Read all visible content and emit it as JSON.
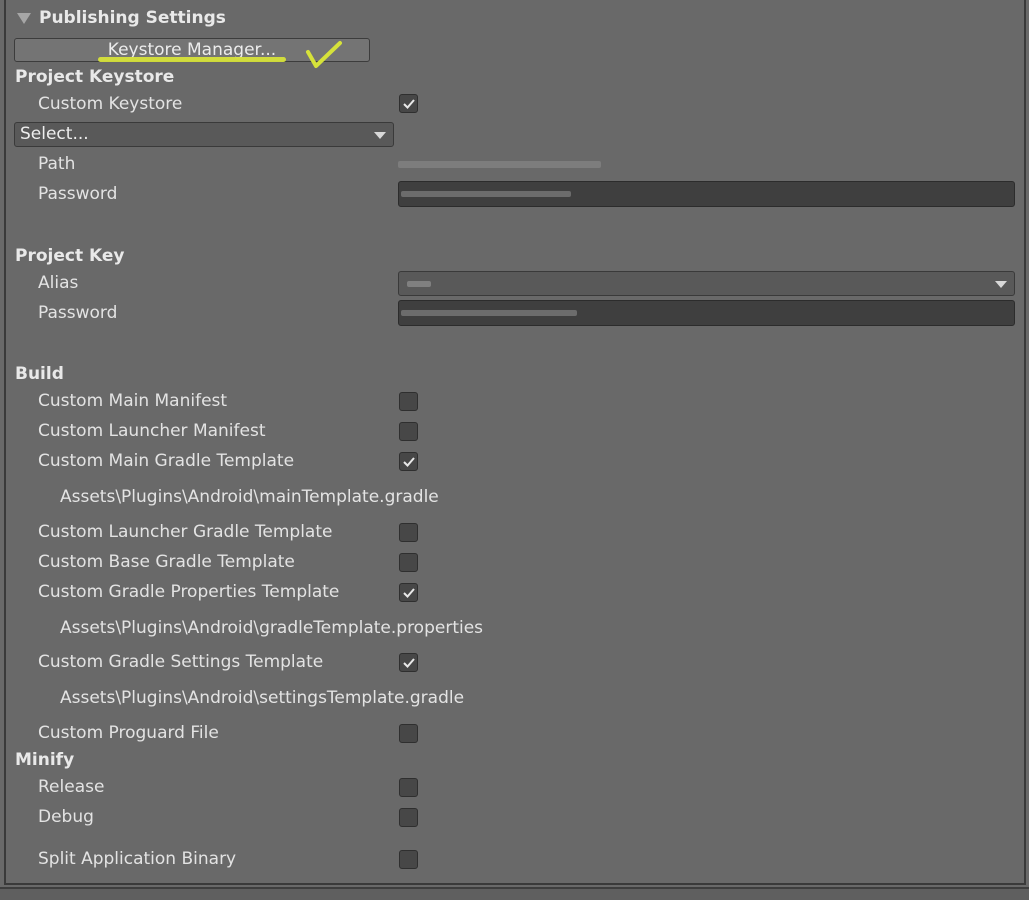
{
  "section_header": "Publishing Settings",
  "keystore_manager_button": "Keystore Manager...",
  "project_keystore": {
    "title": "Project Keystore",
    "custom_keystore_label": "Custom Keystore",
    "custom_keystore_checked": true,
    "select_value": "Select...",
    "path_label": "Path",
    "password_label": "Password"
  },
  "project_key": {
    "title": "Project Key",
    "alias_label": "Alias",
    "password_label": "Password"
  },
  "build": {
    "title": "Build",
    "items": [
      {
        "label": "Custom Main Manifest",
        "checked": false
      },
      {
        "label": "Custom Launcher Manifest",
        "checked": false
      },
      {
        "label": "Custom Main Gradle Template",
        "checked": true,
        "path": "Assets\\Plugins\\Android\\mainTemplate.gradle"
      },
      {
        "label": "Custom Launcher Gradle Template",
        "checked": false
      },
      {
        "label": "Custom Base Gradle Template",
        "checked": false
      },
      {
        "label": "Custom Gradle Properties Template",
        "checked": true,
        "path": "Assets\\Plugins\\Android\\gradleTemplate.properties"
      },
      {
        "label": "Custom Gradle Settings Template",
        "checked": true,
        "path": "Assets\\Plugins\\Android\\settingsTemplate.gradle"
      },
      {
        "label": "Custom Proguard File",
        "checked": false
      }
    ]
  },
  "minify": {
    "title": "Minify",
    "items": [
      {
        "label": "Release",
        "checked": false
      },
      {
        "label": "Debug",
        "checked": false
      }
    ]
  },
  "split_binary": {
    "label": "Split Application Binary",
    "checked": false
  }
}
